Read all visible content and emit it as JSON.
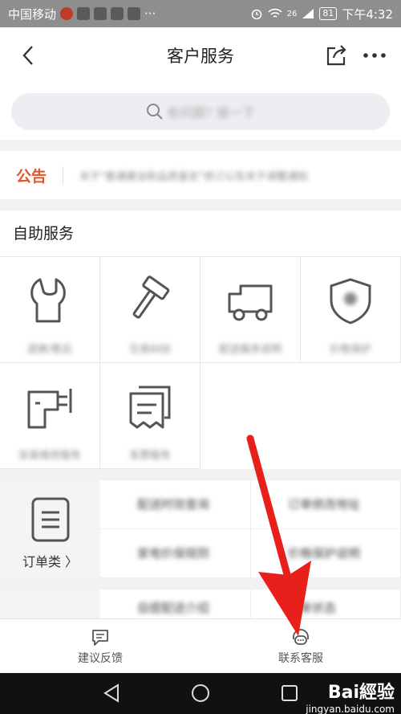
{
  "status_bar": {
    "carrier": "中国移动",
    "network": "26",
    "battery": "81",
    "time": "下午4:32"
  },
  "nav": {
    "title": "客户服务"
  },
  "search": {
    "placeholder": "有问题? 搜一下"
  },
  "notice": {
    "label": "公告",
    "text": "关于\"普通建设和品质鉴定\"修订公告关于调整通知"
  },
  "self_service": {
    "title": "自助服务",
    "items": [
      {
        "label": "退换/售后",
        "icon": "wrench-icon"
      },
      {
        "label": "交易纠纷",
        "icon": "gavel-icon"
      },
      {
        "label": "配送服务说明",
        "icon": "truck-icon"
      },
      {
        "label": "价格保护",
        "icon": "shield-icon"
      },
      {
        "label": "安装维修服务",
        "icon": "drill-icon"
      },
      {
        "label": "发票服务",
        "icon": "invoice-icon"
      }
    ]
  },
  "orders": {
    "category_label": "订单类",
    "items": [
      "配送时效查询",
      "订单修改地址",
      "家电价保规则",
      "价格保护说明"
    ],
    "items_more": [
      "自提配送介绍",
      "订单状态"
    ]
  },
  "bottom_tabs": {
    "feedback": "建议反馈",
    "contact": "联系客服"
  },
  "watermark": {
    "brand": "Bai經验",
    "url": "jingyan.baidu.com"
  },
  "colors": {
    "accent": "#e0572b",
    "arrow": "#e8201c"
  }
}
